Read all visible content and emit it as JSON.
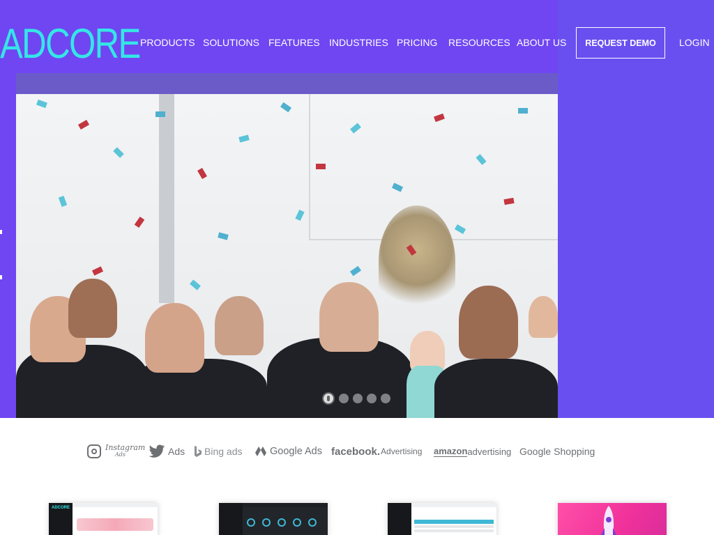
{
  "header": {
    "logo_text": "ADCORE",
    "nav": [
      {
        "label": "PRODUCTS"
      },
      {
        "label": "SOLUTIONS"
      },
      {
        "label": "FEATURES"
      },
      {
        "label": "INDUSTRIES"
      },
      {
        "label": "PRICING"
      },
      {
        "label": "RESOURCES"
      },
      {
        "label": "ABOUT US"
      }
    ],
    "request_demo_label": "REQUEST DEMO",
    "login_label": "LOGIN"
  },
  "hero": {
    "slides_count": 5,
    "active_slide": 1
  },
  "brands": {
    "instagram": {
      "name": "Instagram",
      "sub": "Ads"
    },
    "twitter": {
      "label": "Ads"
    },
    "bing": {
      "label": "Bing ads"
    },
    "google_ads": {
      "label": "Google Ads"
    },
    "facebook": {
      "name": "facebook.",
      "sub": "Advertising"
    },
    "amazon": {
      "name": "amazon",
      "sub": "advertising"
    },
    "google_shopping": {
      "name": "Google",
      "sub": "Shopping"
    }
  },
  "cards": {
    "card1_logo": "ADCORE"
  },
  "colors": {
    "hero_bg": "#6f46f2",
    "logo": "#35e6e6",
    "brand_gray": "#6d6f73"
  }
}
